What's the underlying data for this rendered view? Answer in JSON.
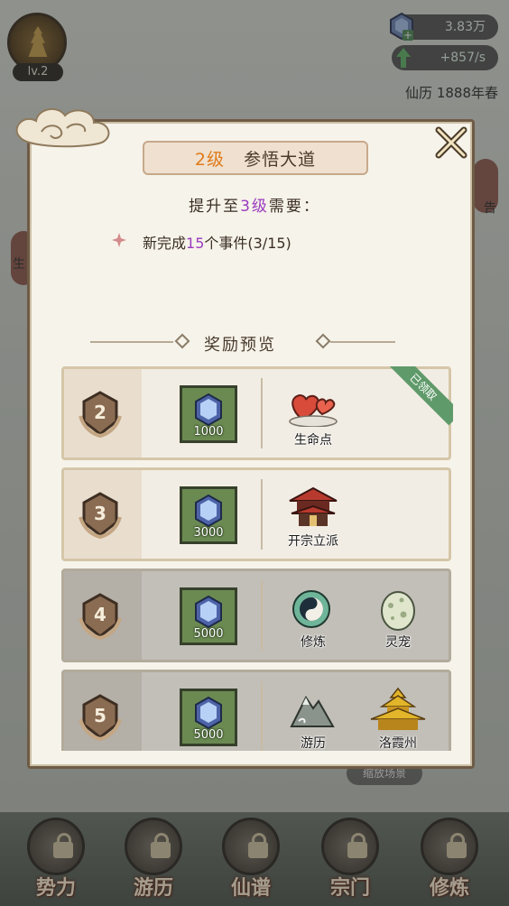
{
  "hud": {
    "level": "lv.2",
    "currency_value": "3.83万",
    "rate_value": "+857/s",
    "calendar": "仙历 1888年春",
    "zoom_button": "缩放场景"
  },
  "side": {
    "left_char": "生",
    "right_char": "告"
  },
  "modal": {
    "title_level": "2级",
    "title_name": "参悟大道",
    "req_prefix": "提升至",
    "req_level": "3级",
    "req_suffix": "需要：",
    "req_item_prefix": "新完成",
    "req_item_count": "15",
    "req_item_suffix": "个事件(3/15)",
    "rewards_header": "奖励预览",
    "claimed_tag": "已领取",
    "rows": [
      {
        "level": "2",
        "gems": "1000",
        "items": [
          {
            "name": "生命点",
            "icon": "hearts-icon"
          }
        ],
        "state": "claimed"
      },
      {
        "level": "3",
        "gems": "3000",
        "items": [
          {
            "name": "开宗立派",
            "icon": "temple-icon"
          }
        ],
        "state": "available"
      },
      {
        "level": "4",
        "gems": "5000",
        "items": [
          {
            "name": "修炼",
            "icon": "yinyang-icon"
          },
          {
            "name": "灵宠",
            "icon": "egg-icon"
          }
        ],
        "state": "locked"
      },
      {
        "level": "5",
        "gems": "5000",
        "items": [
          {
            "name": "游历",
            "icon": "mountain-icon"
          },
          {
            "name": "洛霞州",
            "icon": "palace-icon"
          }
        ],
        "state": "locked"
      }
    ]
  },
  "nav": [
    {
      "label": "势力"
    },
    {
      "label": "游历"
    },
    {
      "label": "仙谱"
    },
    {
      "label": "宗门"
    },
    {
      "label": "修炼"
    }
  ]
}
